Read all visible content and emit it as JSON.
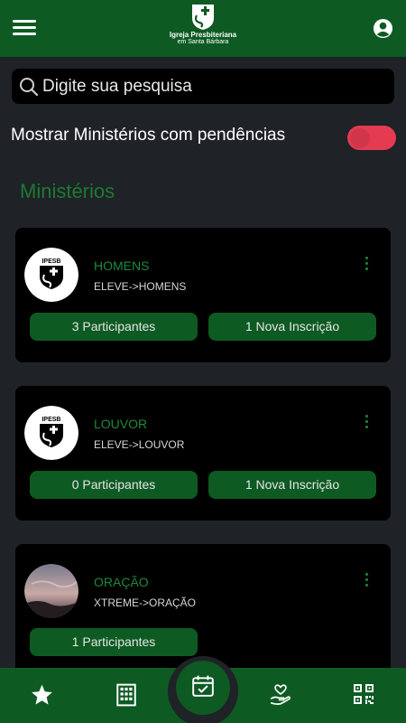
{
  "header": {
    "org_name_line1": "Igreja Presbiteriana",
    "org_name_line2": "em Santa Bárbara"
  },
  "search": {
    "placeholder": "Digite sua pesquisa",
    "value": ""
  },
  "filter": {
    "label": "Mostrar Ministérios com pendências",
    "enabled": true
  },
  "section": {
    "title": "Ministérios"
  },
  "ministries": [
    {
      "name": "HOMENS",
      "path": "ELEVE->HOMENS",
      "logo_text": "IPESB",
      "participants": "3 Participantes",
      "registrations": "1 Nova Inscrição"
    },
    {
      "name": "LOUVOR",
      "path": "ELEVE->LOUVOR",
      "logo_text": "IPESB",
      "participants": "0 Participantes",
      "registrations": "1 Nova Inscrição"
    },
    {
      "name": "ORAÇÃO",
      "path": "XTREME->ORAÇÃO",
      "participants": "1 Participantes"
    }
  ],
  "bottom_nav": [
    "star-icon",
    "building-icon",
    "calendar-check-icon",
    "hand-heart-icon",
    "qr-code-icon"
  ],
  "colors": {
    "primary_green": "#0d5a23",
    "text_green": "#1c8a3a",
    "toggle_red": "#e43b51",
    "background": "#1f2226",
    "card": "#000000"
  }
}
